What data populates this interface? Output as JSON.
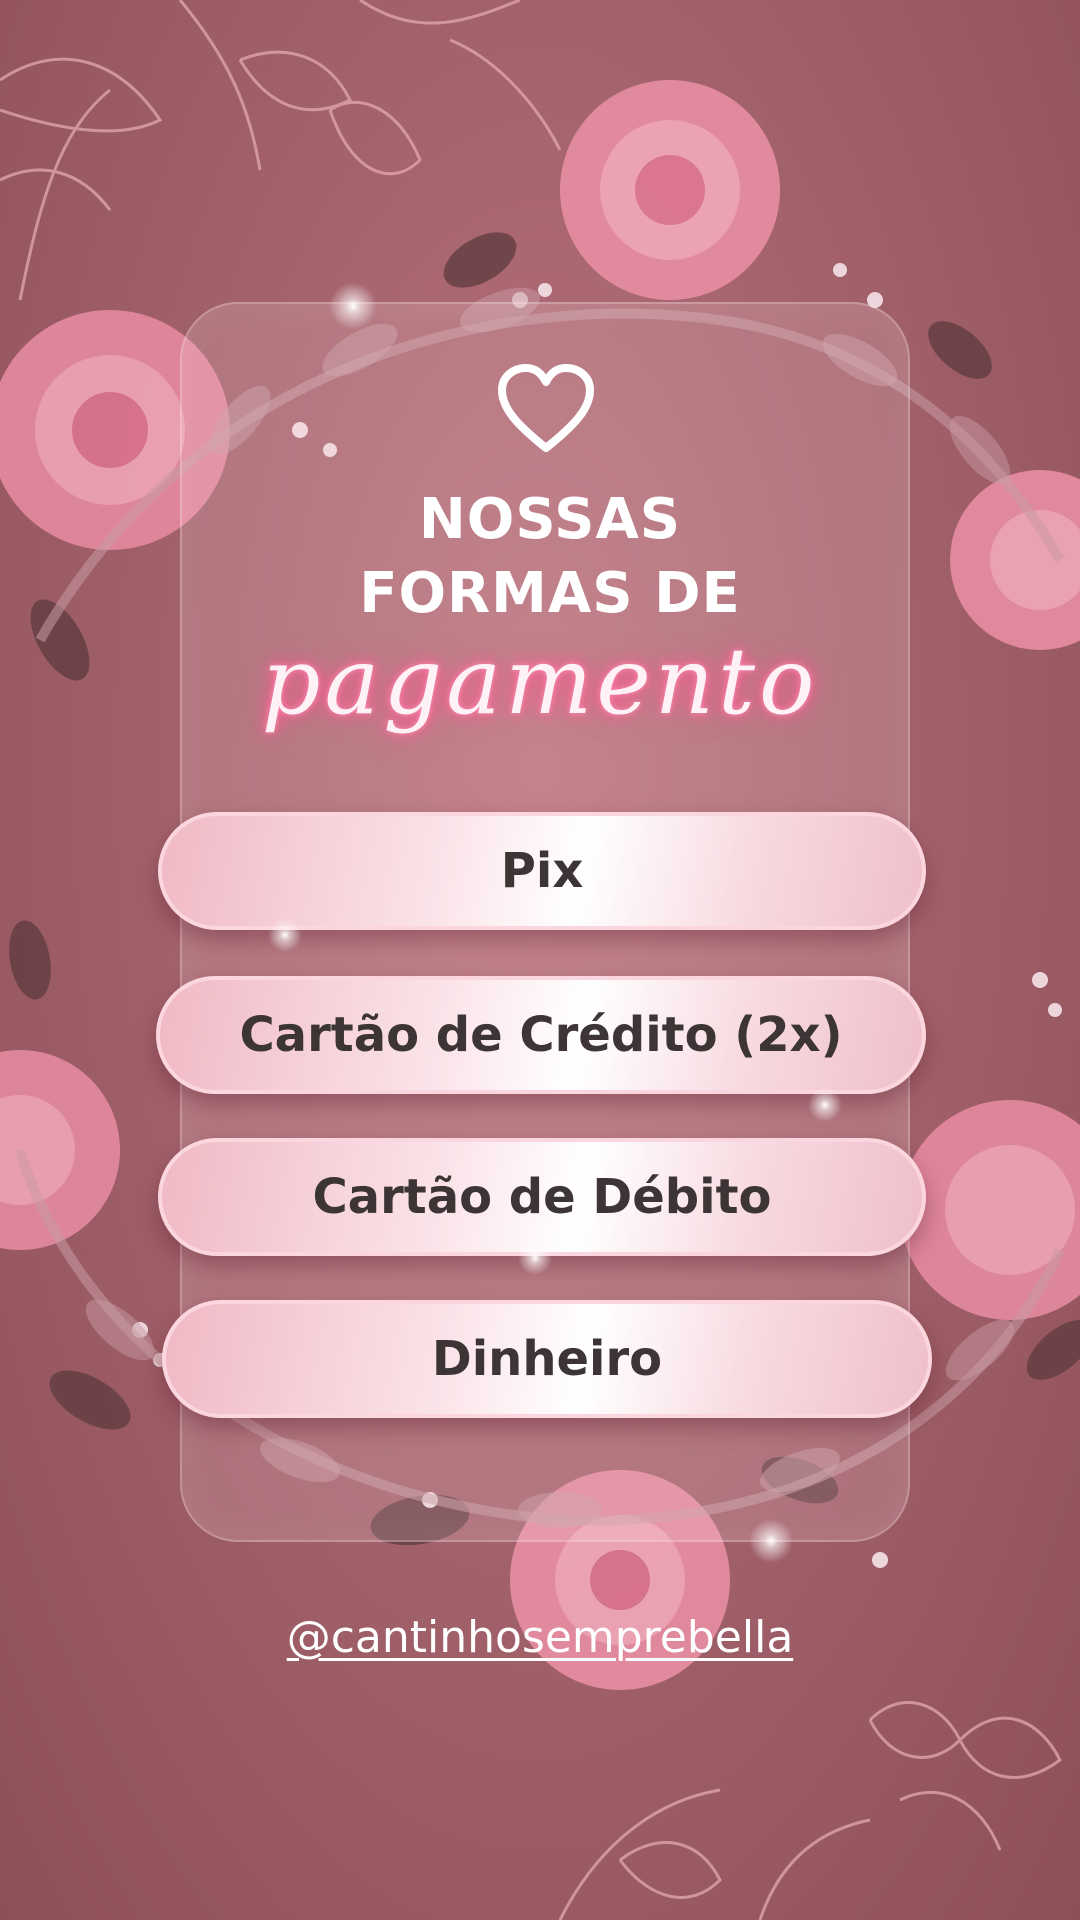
{
  "heading": {
    "line1": "NOSSAS",
    "line2": "FORMAS DE",
    "script_word": "pagamento"
  },
  "payment_options": [
    {
      "label": "Pix"
    },
    {
      "label": "Cartão de Crédito (2x)"
    },
    {
      "label": "Cartão de Débito"
    },
    {
      "label": "Dinheiro"
    }
  ],
  "footer": {
    "handle": "@cantinhosemprebella"
  },
  "icons": {
    "top": "heart-icon"
  },
  "colors": {
    "background": "#a4636c",
    "button_text": "#3d3535",
    "neon_glow": "#ff5d93",
    "card_border": "#fbd6de"
  }
}
